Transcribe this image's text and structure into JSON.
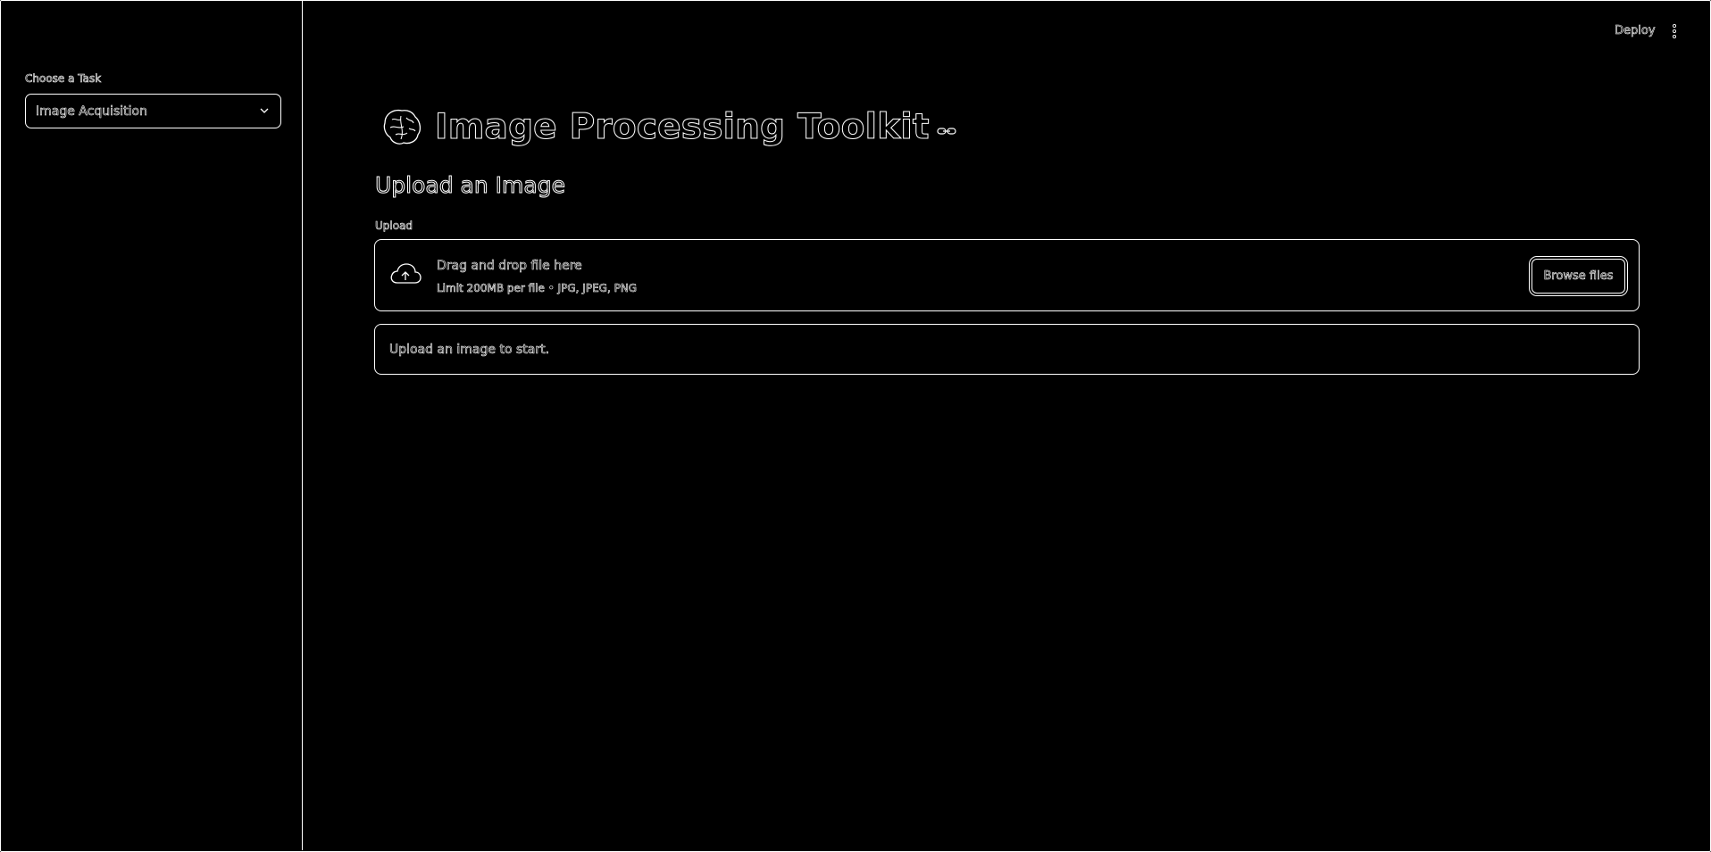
{
  "sidebar": {
    "task_label": "Choose a Task",
    "task_select": {
      "selected": "Image Acquisition"
    }
  },
  "header": {
    "deploy_label": "Deploy",
    "menu_icon": "kebab-menu-icon"
  },
  "main": {
    "title": "Image Processing Toolkit",
    "title_icon": "brain-icon",
    "subheader": "Upload an Image",
    "uploader": {
      "label": "Upload",
      "drop_title": "Drag and drop file here",
      "limit_text": "Limit 200MB per file • JPG, JPEG, PNG",
      "browse_label": "Browse files",
      "icon": "cloud-upload-icon"
    },
    "info_message": "Upload an image to start."
  },
  "colors": {
    "background": "#000000",
    "outline": "#ffffff"
  }
}
